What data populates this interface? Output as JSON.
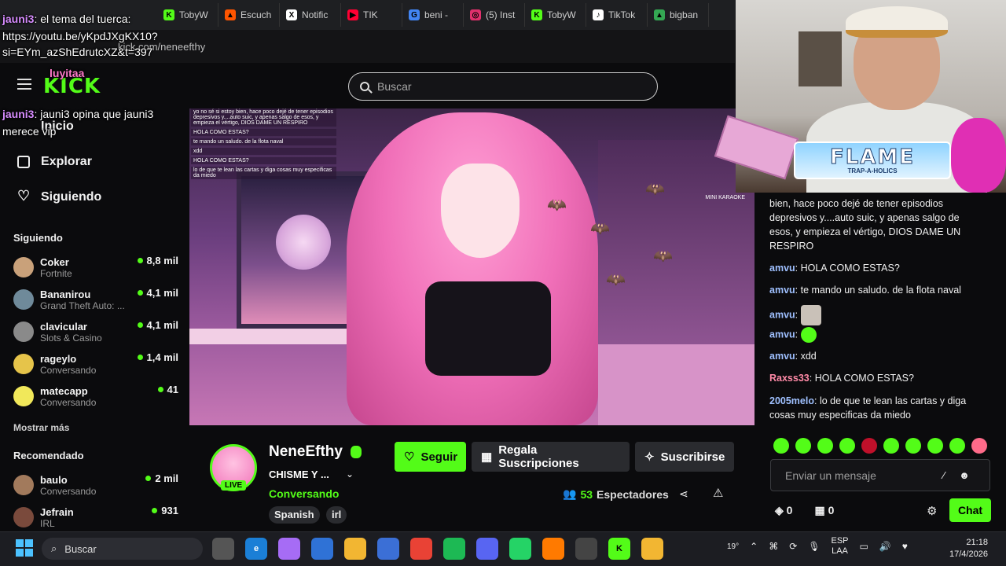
{
  "browser": {
    "address": "kick.com/neneefthy",
    "tabs": [
      {
        "label": "TobyW",
        "color": "#53fc18",
        "glyph": "K"
      },
      {
        "label": "Escuch",
        "color": "#ff5500",
        "glyph": "▲"
      },
      {
        "label": "Notific",
        "color": "#ffffff",
        "glyph": "X"
      },
      {
        "label": "TIK",
        "color": "#ff0033",
        "glyph": "▶"
      },
      {
        "label": "beni -",
        "color": "#4285f4",
        "glyph": "G"
      },
      {
        "label": "(5) Inst",
        "color": "#e1306c",
        "glyph": "◎"
      },
      {
        "label": "TobyW",
        "color": "#53fc18",
        "glyph": "K"
      },
      {
        "label": "TikTok",
        "color": "#ffffff",
        "glyph": "♪"
      },
      {
        "label": "bigban",
        "color": "#34a853",
        "glyph": "▲"
      }
    ]
  },
  "overlay_chat": [
    {
      "user": "jauni3",
      "text": "el tema del tuerca:"
    },
    {
      "user": "",
      "text": "https://youtu.be/yKpdJXgKX10?"
    },
    {
      "user": "",
      "text": "si=EYm_azShEdrutcXZ&t=397"
    },
    {
      "user": "luyitaa",
      "text": ""
    },
    {
      "user": "jauni3",
      "text": "jauni3 opina que jauni3"
    },
    {
      "user": "",
      "text": "merece vip"
    }
  ],
  "header": {
    "logo": "KICK",
    "search_placeholder": "Buscar"
  },
  "sidebar": {
    "nav": [
      {
        "label": "Inicio"
      },
      {
        "label": "Explorar"
      },
      {
        "label": "Siguiendo"
      }
    ],
    "following_title": "Siguiendo",
    "following": [
      {
        "name": "Coker",
        "category": "Fortnite",
        "viewers": "8,8 mil",
        "color": "#c9a17a"
      },
      {
        "name": "Bananirou",
        "category": "Grand Theft Auto: ...",
        "viewers": "4,1 mil",
        "color": "#6f8a9a"
      },
      {
        "name": "clavicular",
        "category": "Slots & Casino",
        "viewers": "4,1 mil",
        "color": "#8a8a8a"
      },
      {
        "name": "rageylo",
        "category": "Conversando",
        "viewers": "1,4 mil",
        "color": "#e6c44a"
      },
      {
        "name": "matecapp",
        "category": "Conversando",
        "viewers": "41",
        "color": "#f1e85a"
      }
    ],
    "show_more": "Mostrar más",
    "recommended_title": "Recomendado",
    "recommended": [
      {
        "name": "baulo",
        "category": "Conversando",
        "viewers": "2 mil",
        "color": "#a27a5c"
      },
      {
        "name": "Jefrain",
        "category": "IRL",
        "viewers": "931",
        "color": "#7a4a3c"
      }
    ]
  },
  "video": {
    "karaoke_label": "MINI KARAOKE",
    "inline_chat": [
      "yo no sé si estoy bien, hace poco dejé de tener episodios depresivos y....auto suic, y apenas salgo de esos, y empieza el vértigo, DIOS DAME UN RESPIRO",
      "HOLA COMO ESTAS?",
      "te mando un saludo. de la flota naval",
      "xdd",
      "HOLA COMO ESTAS?",
      "lo de que te lean las cartas y diga cosas muy especificas da miedo"
    ]
  },
  "stream": {
    "name": "NeneEfthy",
    "title": "CHISME Y ...",
    "category": "Conversando",
    "live_badge": "LIVE",
    "tags": [
      "Spanish",
      "irl"
    ],
    "follow_label": "Seguir",
    "gift_label": "Regala Suscripciones",
    "subscribe_label": "Suscribirse",
    "viewers_count": "53",
    "viewers_label": "Espectadores"
  },
  "webcam": {
    "banner_title": "FLAME",
    "banner_sub": "TRAP-A-HOLICS"
  },
  "chat": {
    "messages": [
      {
        "user": "",
        "text": "bien, hace poco dejé de tener episodios depresivos y....auto suic, y apenas salgo de esos, y empieza el vértigo, DIOS DAME UN RESPIRO",
        "color": "blue"
      },
      {
        "user": "amvu",
        "text": "HOLA COMO ESTAS?",
        "color": "blue"
      },
      {
        "user": "amvu",
        "text": "te mando un saludo. de la flota naval",
        "color": "blue"
      },
      {
        "user": "amvu",
        "text": "",
        "color": "blue"
      },
      {
        "user": "amvu",
        "text": "",
        "color": "blue"
      },
      {
        "user": "amvu",
        "text": "xdd",
        "color": "blue"
      },
      {
        "user": "Raxss33",
        "text": "HOLA COMO ESTAS?",
        "color": "pink"
      },
      {
        "user": "2005melo",
        "text": "lo de que te lean las cartas y diga cosas muy especificas da miedo",
        "color": "blue"
      }
    ],
    "input_placeholder": "Enviar un mensaje",
    "points": "0",
    "gifts": "0",
    "send_label": "Chat"
  },
  "taskbar": {
    "search_placeholder": "Buscar",
    "weather": "19°",
    "lang_top": "ESP",
    "lang_bottom": "LAA",
    "time": "21:18",
    "date": "17/4/2026"
  }
}
